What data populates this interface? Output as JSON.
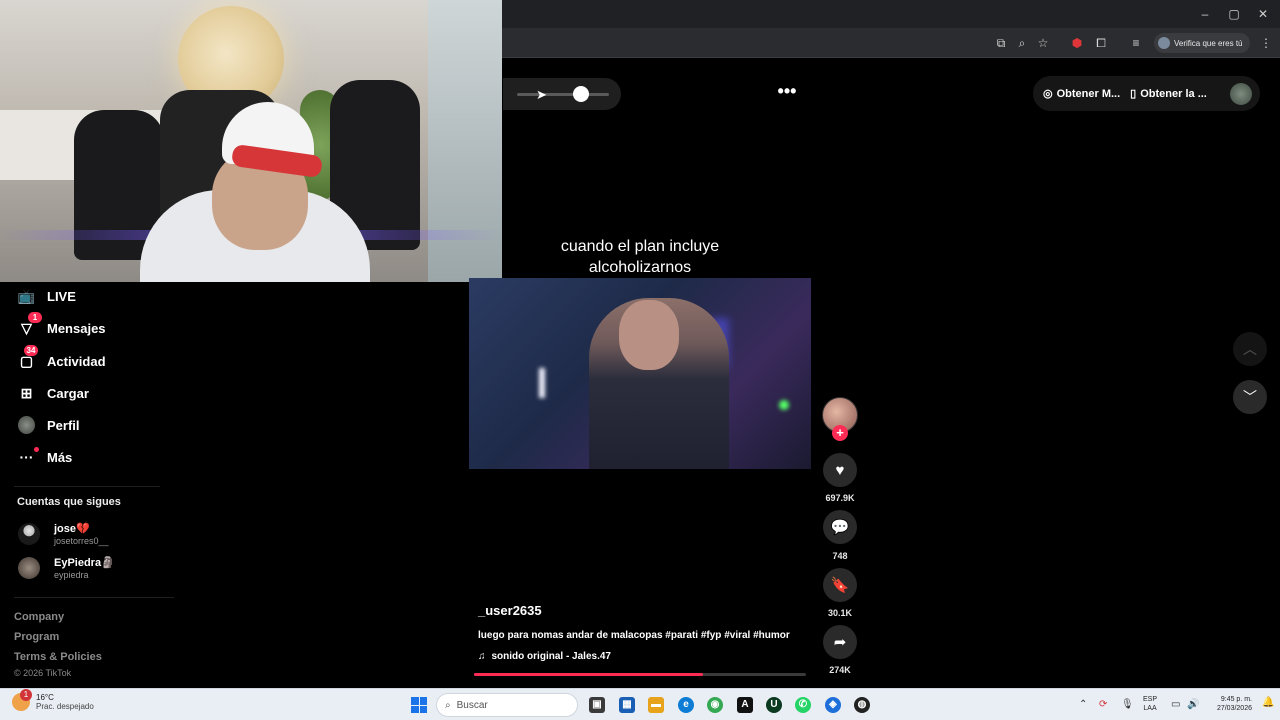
{
  "browser": {
    "profile_label": "Verifica que eres tú",
    "window_controls": {
      "minimize": "–",
      "maximize": "▢",
      "close": "✕"
    }
  },
  "player": {
    "volume_level": 0.7,
    "more_icon": "•••"
  },
  "header": {
    "get_mobile_label": "Obtener M...",
    "get_app_label": "Obtener la ..."
  },
  "sidebar": {
    "items": [
      {
        "label": "LIVE",
        "icon": "live-icon"
      },
      {
        "label": "Mensajes",
        "icon": "messages-icon",
        "badge": "1"
      },
      {
        "label": "Actividad",
        "icon": "activity-icon",
        "badge": "34"
      },
      {
        "label": "Cargar",
        "icon": "upload-icon"
      },
      {
        "label": "Perfil",
        "icon": "avatar"
      },
      {
        "label": "Más",
        "icon": "more-icon"
      }
    ],
    "following_title": "Cuentas que sigues",
    "following": [
      {
        "name": "jose💔",
        "handle": "josetorres0__"
      },
      {
        "name": "EyPiedra🗿",
        "handle": "eypiedra"
      }
    ],
    "footer_links": [
      "Company",
      "Program",
      "Terms & Policies"
    ],
    "copyright": "© 2026 TikTok"
  },
  "video": {
    "caption_overlay": "cuando el plan incluye alcoholizarnos",
    "username": "_user2635",
    "description": "luego para nomas andar de malacopas #parati #fyp #viral #humor",
    "music": "sonido original - Jales.47",
    "progress": 0.69
  },
  "actions": {
    "likes": "697.9K",
    "comments": "748",
    "saves": "30.1K",
    "shares": "274K"
  },
  "taskbar": {
    "temperature": "16°C",
    "weather_desc": "Prac. despejado",
    "weather_badge": "1",
    "search_placeholder": "Buscar",
    "lang_line1": "ESP",
    "lang_line2": "LAA",
    "time": "9:45 p. m.",
    "date": "27/03/2026"
  },
  "colors": {
    "accent": "#fe2c55",
    "background": "#000000",
    "taskbar": "#e9eef5"
  }
}
